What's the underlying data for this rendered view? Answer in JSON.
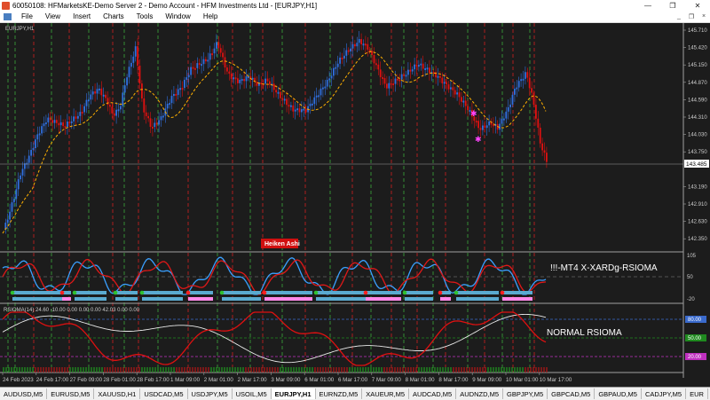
{
  "window": {
    "title": "60050108: HFMarketsKE-Demo Server 2 - Demo Account - HFM Investments Ltd - [EURJPY,H1]",
    "min_glyph": "—",
    "max_glyph": "❐",
    "close_glyph": "✕"
  },
  "menu": {
    "items": [
      "File",
      "View",
      "Insert",
      "Charts",
      "Tools",
      "Window",
      "Help"
    ],
    "ctl_min": "_",
    "ctl_restore": "❐",
    "ctl_close": "×"
  },
  "chart": {
    "symbol_label": "EURJPY,H1",
    "price_ticks": [
      "145.710",
      "145.420",
      "145.150",
      "144.870",
      "144.590",
      "144.310",
      "144.030",
      "143.750",
      "143.485",
      "143.190",
      "142.910",
      "142.630",
      "142.350"
    ],
    "current_price": "143.485",
    "heiken_label": "Heiken Ashi",
    "xard_label": "!!!-MT4 X-XARDg-RSIOMA",
    "xard_axis": [
      "105",
      "50",
      "-20"
    ],
    "rsioma_header": "RSIOMA(14) 24.60 -10.00 0.00 0.00 0.00 42.03 0.00 0.00",
    "rsioma_label": "NORMAL RSIOMA",
    "rsioma_levels": [
      "80.00",
      "50.00",
      "20.00"
    ],
    "time_labels": [
      "24 Feb 2023",
      "24 Feb 17:00",
      "27 Feb 09:00",
      "28 Feb 01:00",
      "28 Feb 17:00",
      "1 Mar 09:00",
      "2 Mar 01:00",
      "2 Mar 17:00",
      "3 Mar 09:00",
      "6 Mar 01:00",
      "6 Mar 17:00",
      "7 Mar 09:00",
      "8 Mar 01:00",
      "8 Mar 17:00",
      "9 Mar 09:00",
      "10 Mar 01:00",
      "10 Mar 17:00"
    ],
    "colors": {
      "bull": "#2f6fe0",
      "bear": "#e01010",
      "ma": "#ffb000",
      "xard_blue": "#3aa0ff",
      "xard_red": "#e01818",
      "bar_blue": "#5aaad0",
      "bar_pink": "#ff88e8",
      "vline_green": "#3aaa3a",
      "vline_red": "#d02020"
    }
  },
  "tabs": [
    {
      "label": "AUDUSD,M5",
      "active": false
    },
    {
      "label": "EURUSD,M5",
      "active": false
    },
    {
      "label": "XAUUSD,H1",
      "active": false
    },
    {
      "label": "USDCAD,M5",
      "active": false
    },
    {
      "label": "USDJPY,M5",
      "active": false
    },
    {
      "label": "USOIL,M5",
      "active": false
    },
    {
      "label": "EURJPY,H1",
      "active": true
    },
    {
      "label": "EURNZD,M5",
      "active": false
    },
    {
      "label": "XAUEUR,M5",
      "active": false
    },
    {
      "label": "AUDCAD,M5",
      "active": false
    },
    {
      "label": "AUDNZD,M5",
      "active": false
    },
    {
      "label": "GBPJPY,M5",
      "active": false
    },
    {
      "label": "GBPCAD,M5",
      "active": false
    },
    {
      "label": "GBPAUD,M5",
      "active": false
    },
    {
      "label": "CADJPY,M5",
      "active": false
    },
    {
      "label": "EUR",
      "active": false
    }
  ]
}
